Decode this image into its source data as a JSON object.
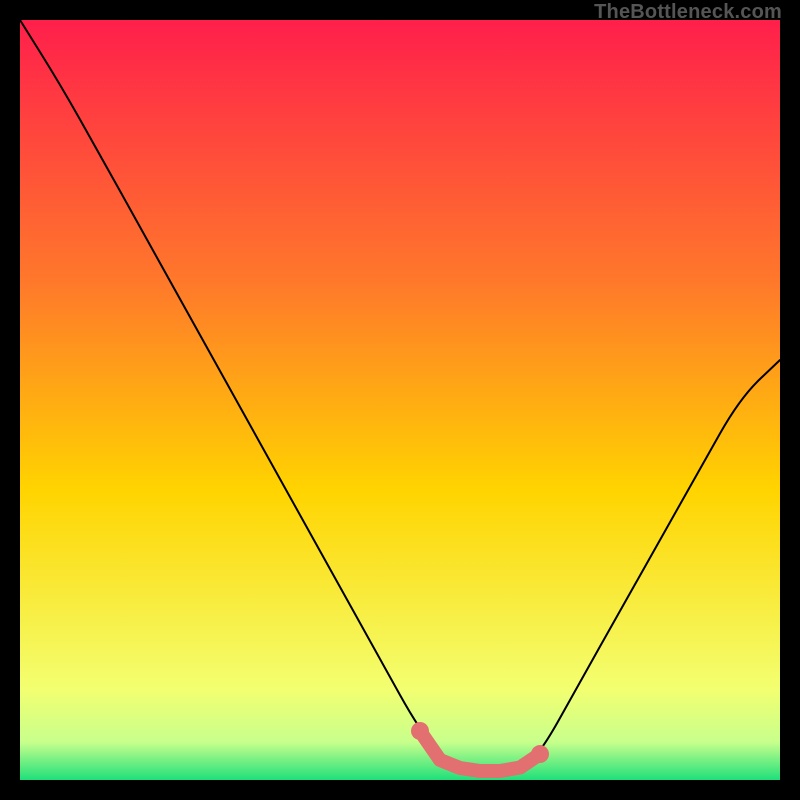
{
  "watermark": "TheBottleneck.com",
  "chart_data": {
    "type": "line",
    "title": "",
    "xlabel": "",
    "ylabel": "",
    "xlim": [
      0,
      100
    ],
    "ylim": [
      0,
      100
    ],
    "grid": false,
    "legend": false,
    "background_gradient": {
      "top_color": "#ff1f4b",
      "mid_color": "#ffd400",
      "bottom_color": "#1fe07a"
    },
    "series": [
      {
        "name": "bottleneck-curve",
        "color": "#000000",
        "x": [
          0,
          5.26,
          10.53,
          15.79,
          21.05,
          26.32,
          31.58,
          36.84,
          42.11,
          47.37,
          52.63,
          56.58,
          60.53,
          63.16,
          65.79,
          68.42,
          73.68,
          78.95,
          84.21,
          89.47,
          94.74,
          100
        ],
        "y": [
          100,
          91.58,
          82.24,
          72.76,
          63.29,
          53.82,
          44.34,
          34.87,
          25.39,
          15.92,
          6.45,
          1.97,
          1.18,
          1.18,
          1.64,
          3.42,
          12.89,
          22.24,
          31.58,
          40.92,
          50.26,
          55.26
        ]
      },
      {
        "name": "minimum-band",
        "color": "#e27070",
        "type": "scatter",
        "x": [
          52.63,
          55.26,
          57.89,
          60.53,
          63.16,
          65.79,
          68.42
        ],
        "y": [
          6.45,
          2.63,
          1.58,
          1.18,
          1.18,
          1.64,
          3.42
        ]
      }
    ]
  }
}
